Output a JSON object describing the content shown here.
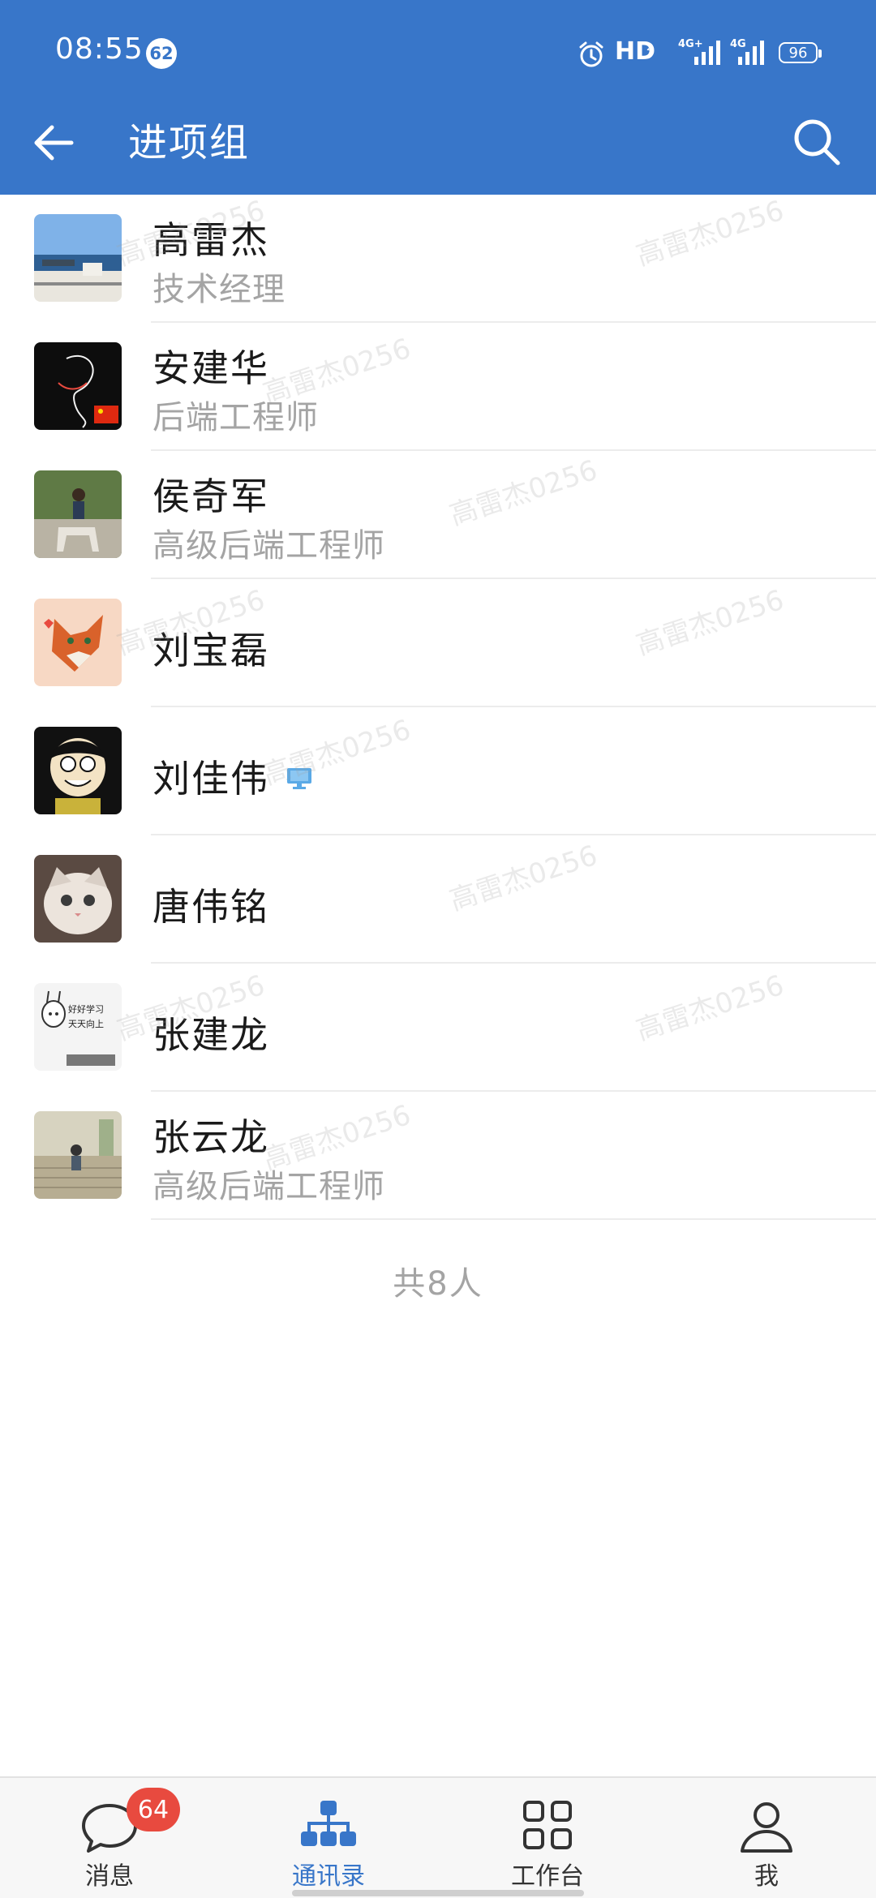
{
  "status_bar": {
    "time": "08:55",
    "notification_count": "62",
    "network": "HD",
    "network_sub": "2",
    "battery": "96"
  },
  "nav": {
    "title": "进项组"
  },
  "watermark": "高雷杰0256",
  "members": [
    {
      "name": "高雷杰",
      "title": "技术经理",
      "avatar_icon": "lake-photo-avatar"
    },
    {
      "name": "安建华",
      "title": "后端工程师",
      "avatar_icon": "line-art-avatar"
    },
    {
      "name": "侯奇军",
      "title": "高级后端工程师",
      "avatar_icon": "horse-rider-avatar"
    },
    {
      "name": "刘宝磊",
      "title": "",
      "avatar_icon": "fox-cartoon-avatar"
    },
    {
      "name": "刘佳伟",
      "title": "",
      "avatar_icon": "cartoon-boy-avatar",
      "status_icon": "desktop-online-icon"
    },
    {
      "name": "唐伟铭",
      "title": "",
      "avatar_icon": "cat-avatar"
    },
    {
      "name": "张建龙",
      "title": "",
      "avatar_icon": "rabbit-sticker-avatar",
      "avatar_text": "好好学习天天向上"
    },
    {
      "name": "张云龙",
      "title": "高级后端工程师",
      "avatar_icon": "child-stairs-avatar"
    }
  ],
  "total_label": "共8人",
  "tabs": [
    {
      "label": "消息",
      "icon": "chat-bubble-icon",
      "badge": "64"
    },
    {
      "label": "通讯录",
      "icon": "org-chart-icon",
      "active": true
    },
    {
      "label": "工作台",
      "icon": "grid-apps-icon"
    },
    {
      "label": "我",
      "icon": "person-icon"
    }
  ],
  "colors": {
    "brand_blue": "#3876c9",
    "badge_red": "#e84a3f",
    "secondary_text": "#a4a4a4"
  }
}
